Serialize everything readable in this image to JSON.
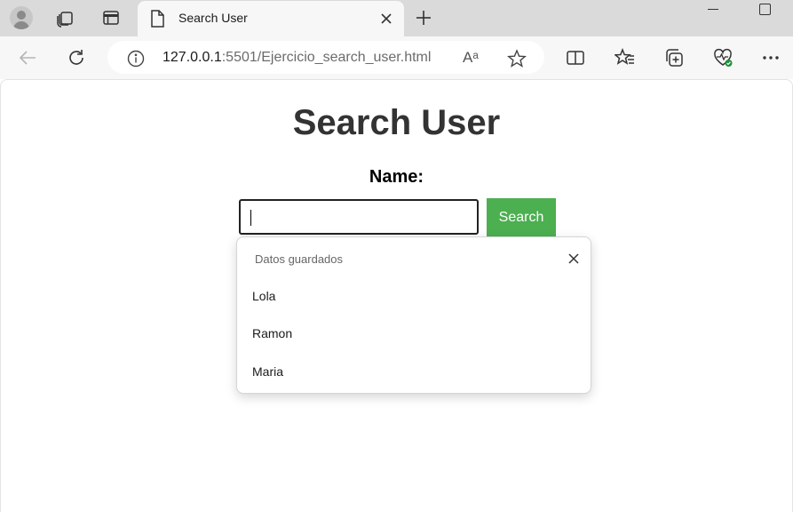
{
  "browser": {
    "tab": {
      "title": "Search User"
    },
    "address": {
      "host": "127.0.0.1",
      "rest": ":5501/Ejercicio_search_user.html"
    },
    "icons": {
      "profile": "profile-icon",
      "workspaces": "workspaces-icon",
      "tab_actions": "tab-actions-icon",
      "page": "page-icon",
      "close": "close-icon",
      "new_tab": "plus-icon",
      "back": "back-arrow-icon",
      "reload": "reload-icon",
      "info": "info-icon",
      "read_aloud": "read-aloud-icon",
      "favorite": "star-icon",
      "split_screen": "split-screen-icon",
      "favorites": "favorites-icon",
      "collections": "collections-icon",
      "browser_essentials": "heart-pulse-icon",
      "more": "more-icon"
    },
    "read_aloud_glyph": "Aᵃ"
  },
  "page": {
    "title": "Search User",
    "name_label": "Name:",
    "search_input": {
      "value": ""
    },
    "search_button": "Search"
  },
  "autofill": {
    "heading": "Datos guardados",
    "items": [
      "Lola",
      "Ramon",
      "Maria"
    ]
  },
  "colors": {
    "accent": "#4caf50",
    "title": "#333333",
    "tabstrip": "#dadada",
    "toolbar": "#f7f7f7"
  }
}
